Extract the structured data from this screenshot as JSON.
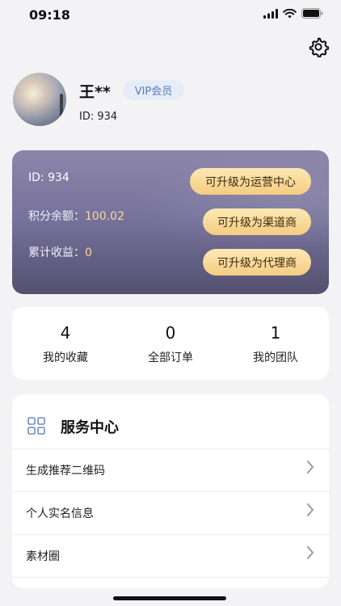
{
  "status_bar": {
    "time": "09:18",
    "icons": [
      "cellular-signal-icon",
      "wifi-icon",
      "battery-icon"
    ]
  },
  "header": {
    "settings_icon": "gear-icon"
  },
  "profile": {
    "name": "王**",
    "badge": "VIP会员",
    "id_text": "ID: 934"
  },
  "member_card": {
    "id_text": "ID: 934",
    "balance_label": "积分余额：",
    "balance_value": "100.02",
    "earnings_label": "累计收益：",
    "earnings_value": "0",
    "upgrade_buttons": [
      "可升级为运营中心",
      "可升级为渠道商",
      "可升级为代理商"
    ]
  },
  "stats": [
    {
      "count": "4",
      "label": "我的收藏"
    },
    {
      "count": "0",
      "label": "全部订单"
    },
    {
      "count": "1",
      "label": "我的团队"
    }
  ],
  "service_center": {
    "title": "服务中心",
    "icon": "grid-icon",
    "items": [
      {
        "label": "生成推荐二维码"
      },
      {
        "label": "个人实名信息"
      },
      {
        "label": "素材圈"
      }
    ]
  },
  "colors": {
    "page_background": "#f3f3f5",
    "card_gradient_top": "#8d86ab",
    "card_gradient_bottom": "#53506f",
    "gold_button": "#f4cc82",
    "gold_text": "#f7d99a",
    "vip_badge_bg": "#e6ecf8",
    "vip_badge_text": "#5d7bc0",
    "icon_blue": "#6d8bc4"
  }
}
